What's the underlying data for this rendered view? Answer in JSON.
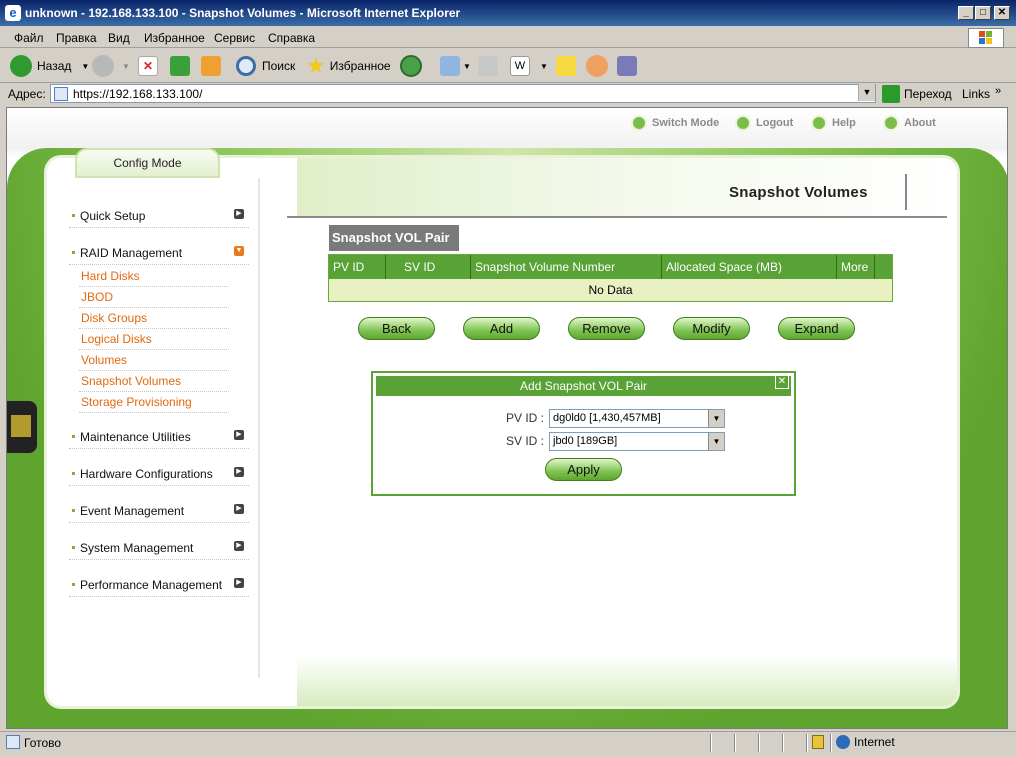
{
  "window": {
    "title": "unknown - 192.168.133.100 - Snapshot Volumes - Microsoft Internet Explorer",
    "controls": {
      "minimize": "_",
      "maximize": "□",
      "close": "✕"
    }
  },
  "menubar": [
    "Файл",
    "Правка",
    "Вид",
    "Избранное",
    "Сервис",
    "Справка"
  ],
  "toolbar": {
    "back": "Назад",
    "search": "Поиск",
    "favorites": "Избранное"
  },
  "address": {
    "label": "Адрес:",
    "url": "https://192.168.133.100/",
    "go": "Переход",
    "links": "Links"
  },
  "topnav": {
    "switch_mode": "Switch Mode",
    "logout": "Logout",
    "help": "Help",
    "about": "About"
  },
  "sidebar": {
    "mode_tab": "Config Mode",
    "items": [
      {
        "label": "Quick Setup"
      },
      {
        "label": "RAID Management"
      },
      {
        "label": "Maintenance Utilities"
      },
      {
        "label": "Hardware Configurations"
      },
      {
        "label": "Event Management"
      },
      {
        "label": "System Management"
      },
      {
        "label": "Performance Management"
      }
    ],
    "raid_sub": [
      "Hard Disks",
      "JBOD",
      "Disk Groups",
      "Logical Disks",
      "Volumes",
      "Snapshot Volumes",
      "Storage Provisioning"
    ]
  },
  "main": {
    "heading": "Snapshot Volumes",
    "section_label": "Snapshot VOL Pair",
    "table": {
      "columns": [
        "PV ID",
        "SV ID",
        "Snapshot Volume Number",
        "Allocated Space (MB)",
        "More"
      ],
      "empty_text": "No Data"
    },
    "buttons": [
      "Back",
      "Add",
      "Remove",
      "Modify",
      "Expand"
    ]
  },
  "dialog": {
    "title": "Add Snapshot VOL Pair",
    "close": "✕",
    "pv_label": "PV ID :",
    "pv_value": "dg0ld0 [1,430,457MB]",
    "sv_label": "SV ID :",
    "sv_value": "jbd0 [189GB]",
    "apply": "Apply"
  },
  "status": {
    "text": "Готово",
    "zone": "Internet"
  }
}
